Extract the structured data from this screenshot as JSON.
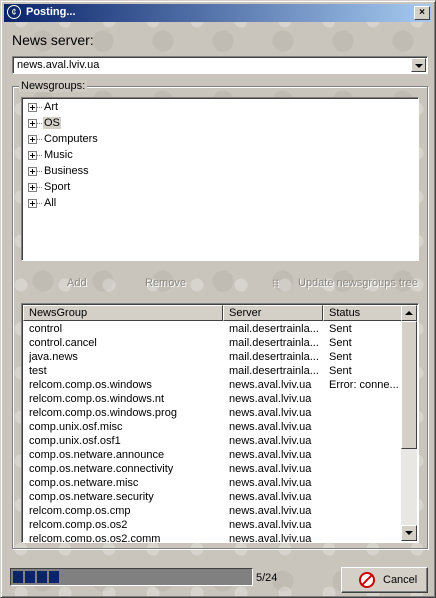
{
  "window": {
    "title": "Posting...",
    "close_symbol": "×"
  },
  "server": {
    "label": "News server:",
    "value": "news.aval.lviv.ua"
  },
  "newsgroups": {
    "label": "Newsgroups:",
    "tree": [
      {
        "label": "Art",
        "selected": false
      },
      {
        "label": "OS",
        "selected": true
      },
      {
        "label": "Computers",
        "selected": false
      },
      {
        "label": "Music",
        "selected": false
      },
      {
        "label": "Business",
        "selected": false
      },
      {
        "label": "Sport",
        "selected": false
      },
      {
        "label": "All",
        "selected": false
      }
    ],
    "actions": {
      "add": "Add",
      "remove": "Remove",
      "update": "Update newsgroups tree"
    }
  },
  "table": {
    "columns": [
      "NewsGroup",
      "Server",
      "Status"
    ],
    "rows": [
      [
        "control",
        "mail.desertrainla...",
        "Sent"
      ],
      [
        "control.cancel",
        "mail.desertrainla...",
        "Sent"
      ],
      [
        "java.news",
        "mail.desertrainla...",
        "Sent"
      ],
      [
        "test",
        "mail.desertrainla...",
        "Sent"
      ],
      [
        "relcom.comp.os.windows",
        "news.aval.lviv.ua",
        "Error: conne..."
      ],
      [
        "relcom.comp.os.windows.nt",
        "news.aval.lviv.ua",
        ""
      ],
      [
        "relcom.comp.os.windows.prog",
        "news.aval.lviv.ua",
        ""
      ],
      [
        "comp.unix.osf.misc",
        "news.aval.lviv.ua",
        ""
      ],
      [
        "comp.unix.osf.osf1",
        "news.aval.lviv.ua",
        ""
      ],
      [
        "comp.os.netware.announce",
        "news.aval.lviv.ua",
        ""
      ],
      [
        "comp.os.netware.connectivity",
        "news.aval.lviv.ua",
        ""
      ],
      [
        "comp.os.netware.misc",
        "news.aval.lviv.ua",
        ""
      ],
      [
        "comp.os.netware.security",
        "news.aval.lviv.ua",
        ""
      ],
      [
        "relcom.comp.os.cmp",
        "news.aval.lviv.ua",
        ""
      ],
      [
        "relcom.comp.os.os2",
        "news.aval.lviv.ua",
        ""
      ],
      [
        "relcom.comp.os.os2.comm",
        "news.aval.lviv.ua",
        ""
      ]
    ]
  },
  "progress": {
    "text": "5/24",
    "fraction": 0.2083
  },
  "cancel_button": {
    "label": "Cancel",
    "icon": "cancel-icon"
  }
}
